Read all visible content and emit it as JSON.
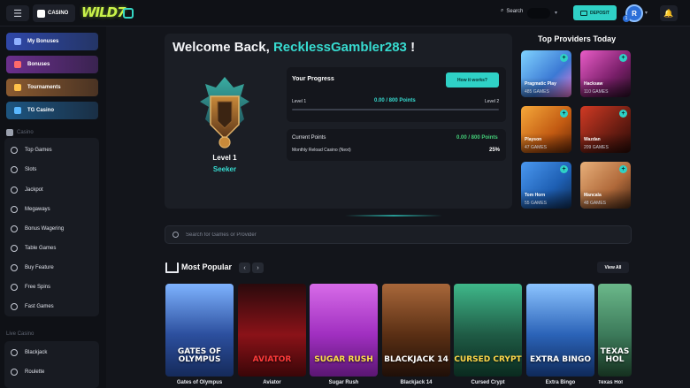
{
  "header": {
    "casino_label": "CASINO",
    "logo_text": "WILD",
    "logo_suffix": "7",
    "search_label": "Search",
    "deposit_label": "DEPOSIT",
    "avatar_initial": "R",
    "avatar_level": "1"
  },
  "sidebar": {
    "promos": [
      {
        "label": "My Bonuses",
        "color": "#3b57c4"
      },
      {
        "label": "Bonuses",
        "color": "#7a3fa8"
      },
      {
        "label": "Tournaments",
        "color": "#a8683a"
      },
      {
        "label": "TG Casino",
        "color": "#1f5f8f"
      }
    ],
    "casino_section": "Casino",
    "casino_items": [
      "Top Games",
      "Slots",
      "Jackpot",
      "Megaways",
      "Bonus Wagering",
      "Table Games",
      "Buy Feature",
      "Free Spins",
      "Fast Games"
    ],
    "live_section": "Live Casino",
    "live_items": [
      "Blackjack",
      "Roulette"
    ]
  },
  "welcome": {
    "prefix": "Welcome Back,",
    "username": "RecklessGambler283",
    "suffix": "!",
    "level": "Level 1",
    "rank": "Seeker"
  },
  "progress": {
    "title": "Your Progress",
    "how_button": "How it works?",
    "level_from": "Level 1",
    "points": "0.00 / 800 Points",
    "level_to": "Level 2",
    "fill_fraction": 0
  },
  "points": {
    "current_label": "Current Points",
    "current_value": "0.00 / 800 Points",
    "reload_label": "Monthly Reload Casino (Next)",
    "reload_value": "25%"
  },
  "providers": {
    "title": "Top Providers Today",
    "items": [
      {
        "name": "Pragmatic Play",
        "count": "485 GAMES",
        "color": "#4a8fd8"
      },
      {
        "name": "Hacksaw",
        "count": "110 GAMES",
        "color": "#8a2f7a"
      },
      {
        "name": "Playson",
        "count": "47 GAMES",
        "color": "#c86a18"
      },
      {
        "name": "Wazdan",
        "count": "209 GAMES",
        "color": "#6b1d12"
      },
      {
        "name": "Tom Horn",
        "count": "55 GAMES",
        "color": "#1e5fb3"
      },
      {
        "name": "Mancala",
        "count": "48 GAMES",
        "color": "#b0693a"
      }
    ]
  },
  "games_search": {
    "placeholder": "Search for Games or Provider"
  },
  "most_popular": {
    "title": "Most Popular",
    "prev": "‹",
    "next": "›",
    "view_all": "View All",
    "games": [
      {
        "name": "Gates of Olympus",
        "art": "GATES OF OLYMPUS",
        "color": "#3a5fae"
      },
      {
        "name": "Aviator",
        "art": "AVIATOR",
        "color": "#7a0f14"
      },
      {
        "name": "Sugar Rush",
        "art": "SUGAR RUSH",
        "color": "#b63ac9"
      },
      {
        "name": "Blackjack 14",
        "art": "BLACKJACK 14",
        "color": "#6b3c1f"
      },
      {
        "name": "Cursed Crypt",
        "art": "CURSED CRYPT",
        "color": "#1f5b45"
      },
      {
        "name": "Extra Bingo",
        "art": "EXTRA BINGO",
        "color": "#2b63b8"
      },
      {
        "name": "Texas Hol",
        "art": "TEXAS HOL",
        "color": "#3c7a5a"
      }
    ]
  }
}
